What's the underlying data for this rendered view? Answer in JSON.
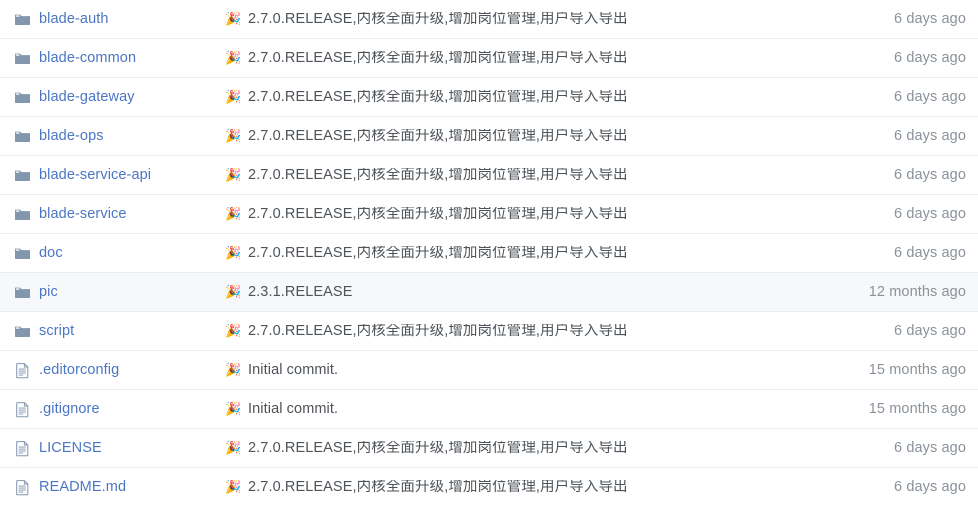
{
  "list": {
    "columns": [
      "name",
      "commit_message",
      "last_updated"
    ],
    "rows": [
      {
        "icon": "folder-icon",
        "kind": "folder",
        "name": "blade-auth",
        "commit_emoji": "🎉",
        "commit_message": "2.7.0.RELEASE,内核全面升级,增加岗位管理,用户导入导出",
        "age": "6 days ago",
        "highlighted": false
      },
      {
        "icon": "folder-icon",
        "kind": "folder",
        "name": "blade-common",
        "commit_emoji": "🎉",
        "commit_message": "2.7.0.RELEASE,内核全面升级,增加岗位管理,用户导入导出",
        "age": "6 days ago",
        "highlighted": false
      },
      {
        "icon": "folder-icon",
        "kind": "folder",
        "name": "blade-gateway",
        "commit_emoji": "🎉",
        "commit_message": "2.7.0.RELEASE,内核全面升级,增加岗位管理,用户导入导出",
        "age": "6 days ago",
        "highlighted": false
      },
      {
        "icon": "folder-icon",
        "kind": "folder",
        "name": "blade-ops",
        "commit_emoji": "🎉",
        "commit_message": "2.7.0.RELEASE,内核全面升级,增加岗位管理,用户导入导出",
        "age": "6 days ago",
        "highlighted": false
      },
      {
        "icon": "folder-icon",
        "kind": "folder",
        "name": "blade-service-api",
        "commit_emoji": "🎉",
        "commit_message": "2.7.0.RELEASE,内核全面升级,增加岗位管理,用户导入导出",
        "age": "6 days ago",
        "highlighted": false
      },
      {
        "icon": "folder-icon",
        "kind": "folder",
        "name": "blade-service",
        "commit_emoji": "🎉",
        "commit_message": "2.7.0.RELEASE,内核全面升级,增加岗位管理,用户导入导出",
        "age": "6 days ago",
        "highlighted": false
      },
      {
        "icon": "folder-icon",
        "kind": "folder",
        "name": "doc",
        "commit_emoji": "🎉",
        "commit_message": "2.7.0.RELEASE,内核全面升级,增加岗位管理,用户导入导出",
        "age": "6 days ago",
        "highlighted": false
      },
      {
        "icon": "folder-icon",
        "kind": "folder",
        "name": "pic",
        "commit_emoji": "🎉",
        "commit_message": "2.3.1.RELEASE",
        "age": "12 months ago",
        "highlighted": true
      },
      {
        "icon": "folder-icon",
        "kind": "folder",
        "name": "script",
        "commit_emoji": "🎉",
        "commit_message": "2.7.0.RELEASE,内核全面升级,增加岗位管理,用户导入导出",
        "age": "6 days ago",
        "highlighted": false
      },
      {
        "icon": "file-icon",
        "kind": "file",
        "name": ".editorconfig",
        "commit_emoji": "🎉",
        "commit_message": "Initial commit.",
        "age": "15 months ago",
        "highlighted": false
      },
      {
        "icon": "file-icon",
        "kind": "file",
        "name": ".gitignore",
        "commit_emoji": "🎉",
        "commit_message": "Initial commit.",
        "age": "15 months ago",
        "highlighted": false
      },
      {
        "icon": "file-icon",
        "kind": "file",
        "name": "LICENSE",
        "commit_emoji": "🎉",
        "commit_message": "2.7.0.RELEASE,内核全面升级,增加岗位管理,用户导入导出",
        "age": "6 days ago",
        "highlighted": false
      },
      {
        "icon": "file-icon",
        "kind": "file",
        "name": "README.md",
        "commit_emoji": "🎉",
        "commit_message": "2.7.0.RELEASE,内核全面升级,增加岗位管理,用户导入导出",
        "age": "6 days ago",
        "highlighted": false
      }
    ]
  },
  "colors": {
    "link": "#4a76c4",
    "commit_text": "#4d5358",
    "age_text": "#8a929b",
    "folder_icon": "#8296ae",
    "file_icon": "#8296ae",
    "row_divider": "#eaecef",
    "row_highlight": "#f7f8f9"
  }
}
